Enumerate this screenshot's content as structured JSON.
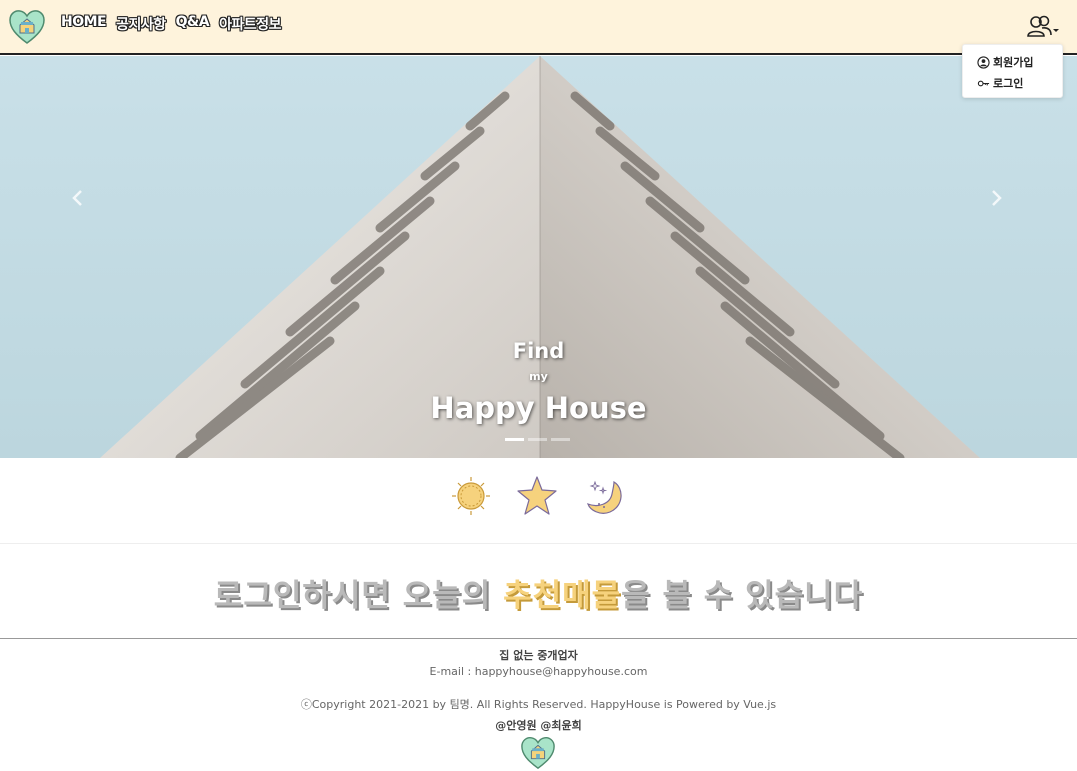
{
  "nav": {
    "links": [
      "HOME",
      "공지사항",
      "Q&A",
      "아파트정보"
    ],
    "user_icon": "users-icon"
  },
  "dropdown": {
    "items": [
      {
        "label": "회원가입",
        "icon": "user-circle-icon"
      },
      {
        "label": "로그인",
        "icon": "key-icon"
      }
    ]
  },
  "carousel": {
    "caption_line1": "Find",
    "caption_line2": "my",
    "caption_line3": "Happy House",
    "slide_count": 3,
    "active_slide": 1,
    "prev_icon": "chevron-left-icon",
    "next_icon": "chevron-right-icon"
  },
  "theme_icons": [
    "sun-icon",
    "star-icon",
    "moon-icon"
  ],
  "promo": {
    "before": "로그인하시면 오늘의 ",
    "highlight": "추천매물",
    "after": "을 볼 수 있습니다"
  },
  "footer": {
    "company": "집 없는 중개업자",
    "email": "E-mail : happyhouse@happyhouse.com",
    "copyright": "ⓒCopyright 2021-2021 by 팀명. All Rights Reserved. HappyHouse is Powered by Vue.js",
    "authors": "@안영원 @최윤희"
  },
  "colors": {
    "navbar_bg": "#fef3dc",
    "accent_yellow": "#f6d27d",
    "heart_green": "#a9e4c9",
    "promo_grey": "#b9b9b9"
  }
}
